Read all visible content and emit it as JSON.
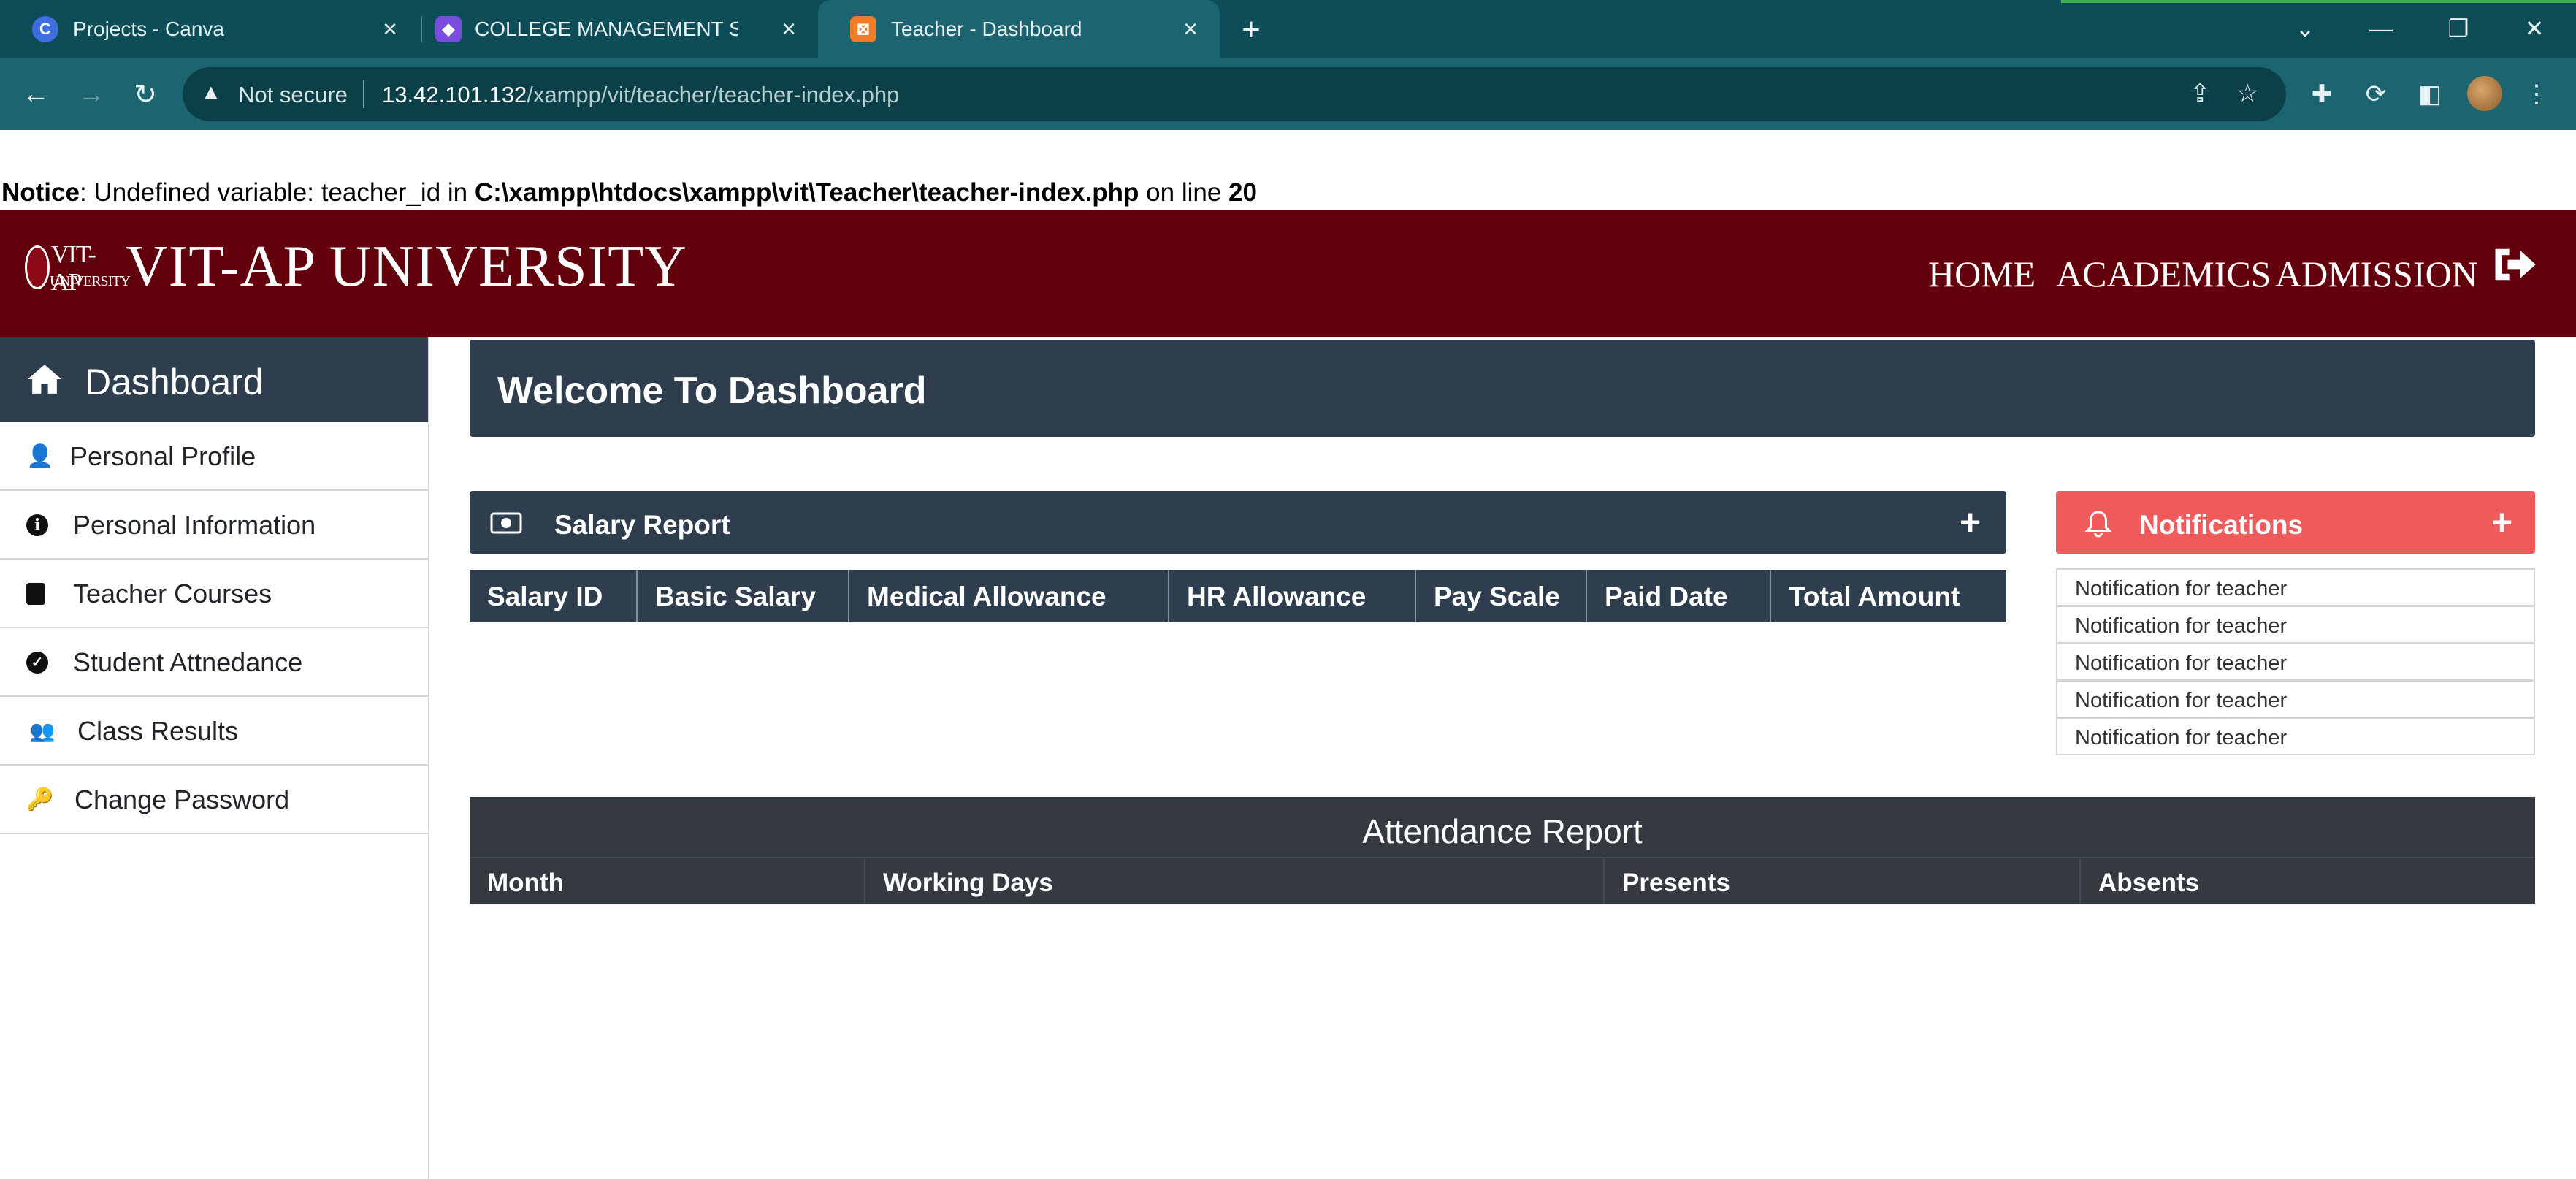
{
  "browser": {
    "tabs": [
      {
        "title": "Projects - Canva",
        "icon": "canva-icon",
        "active": false
      },
      {
        "title": "COLLEGE MANAGEMENT SYSTEM",
        "icon": "app-icon",
        "active": false
      },
      {
        "title": "Teacher - Dashboard",
        "icon": "xampp-icon",
        "active": true
      }
    ],
    "security_label": "Not secure",
    "url_host": "13.42.101.132",
    "url_path": "/xampp/vit/teacher/teacher-index.php"
  },
  "notice": {
    "label": "Notice",
    "message": ": Undefined variable: teacher_id in ",
    "path": "C:\\xampp\\htdocs\\xampp\\vit\\Teacher\\teacher-index.php",
    "online": " on line ",
    "line": "20"
  },
  "header": {
    "logo_text_1": "VIT-AP",
    "logo_text_2": "UNIVERSITY",
    "brand": "VIT-AP UNIVERSITY",
    "nav": [
      "HOME",
      "ACADEMICS",
      "ADMISSION"
    ],
    "accent": "#62000b"
  },
  "sidebar": {
    "title": "Dashboard",
    "items": [
      {
        "label": "Personal Profile",
        "icon": "user-icon"
      },
      {
        "label": "Personal Information",
        "icon": "info-icon"
      },
      {
        "label": "Teacher Courses",
        "icon": "book-icon"
      },
      {
        "label": "Student Attnedance",
        "icon": "check-circle-icon"
      },
      {
        "label": "Class Results",
        "icon": "users-icon"
      },
      {
        "label": "Change Password",
        "icon": "key-icon"
      }
    ]
  },
  "main": {
    "welcome": "Welcome To Dashboard",
    "salary": {
      "title": "Salary Report",
      "columns": [
        "Salary ID",
        "Basic Salary",
        "Medical Allowance",
        "HR Allowance",
        "Pay Scale",
        "Paid Date",
        "Total Amount"
      ]
    },
    "notifications": {
      "title": "Notifications",
      "items": [
        "Notification for teacher",
        "Notification for teacher",
        "Notification for teacher",
        "Notification for teacher",
        "Notification for teacher"
      ],
      "accent": "#ef5a5a"
    },
    "attendance": {
      "title": "Attendance Report",
      "columns": [
        "Month",
        "Working Days",
        "Presents",
        "Absents"
      ]
    },
    "panel_color": "#2f3e4e"
  }
}
